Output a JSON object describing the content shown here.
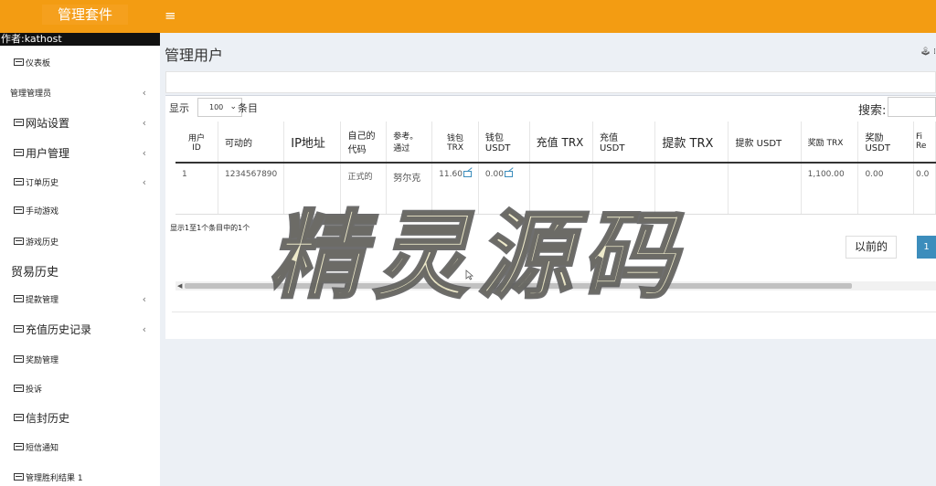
{
  "header": {
    "brand": "管理套件",
    "menu_icon": "hamburger-icon",
    "accent_color": "#f39c12"
  },
  "sidebar": {
    "author": "作者:kathost",
    "items": [
      {
        "label": "仪表板",
        "icon": "list-icon",
        "has_children": false
      },
      {
        "label": "管理管理员",
        "icon": "",
        "has_children": true
      },
      {
        "label": "网站设置",
        "icon": "list-icon",
        "has_children": true
      },
      {
        "label": "用户管理",
        "icon": "list-icon",
        "has_children": true
      },
      {
        "label": "订单历史",
        "icon": "list-icon",
        "has_children": true
      },
      {
        "label": "手动游戏",
        "icon": "list-icon",
        "has_children": false
      },
      {
        "label": "游戏历史",
        "icon": "list-icon",
        "has_children": false
      },
      {
        "label": "贸易历史",
        "icon": "",
        "has_children": false
      },
      {
        "label": "提款管理",
        "icon": "list-icon",
        "has_children": true
      },
      {
        "label": "充值历史记录",
        "icon": "list-icon",
        "has_children": true
      },
      {
        "label": "奖励管理",
        "icon": "list-icon",
        "has_children": false
      },
      {
        "label": "投诉",
        "icon": "list-icon",
        "has_children": false
      },
      {
        "label": "信封历史",
        "icon": "list-icon",
        "has_children": false
      },
      {
        "label": "短信通知",
        "icon": "list-icon",
        "has_children": false
      },
      {
        "label": "管理胜利结果 1",
        "icon": "list-icon",
        "has_children": false
      }
    ]
  },
  "page": {
    "title": "管理用户",
    "right_text": "🕹 ⁞"
  },
  "table_controls": {
    "show_label": "显示",
    "page_length": "100",
    "entries_label": "条目",
    "search_label": "搜索:",
    "search_value": ""
  },
  "table": {
    "columns": [
      "用户\nID",
      "可动的",
      "IP地址",
      "自己的\n代码",
      "参考。\n通过",
      "钱包\nTRX",
      "钱包\nUSDT",
      "充值 TRX",
      "充值\nUSDT",
      "提款 TRX",
      "提款 USDT",
      "奖励 TRX",
      "奖励\nUSDT",
      "Fi\nRe"
    ],
    "rows": [
      [
        "1",
        "1234567890",
        "",
        "正式的",
        "努尔克",
        "11.60",
        "0.00",
        "",
        "",
        "",
        "",
        "1,100.00",
        "0.00",
        "0.0"
      ]
    ]
  },
  "footer": {
    "info": "显示1至1个条目中的1个",
    "prev_label": "以前的",
    "current_page": "1"
  },
  "watermark": {
    "text": "精灵源码"
  }
}
